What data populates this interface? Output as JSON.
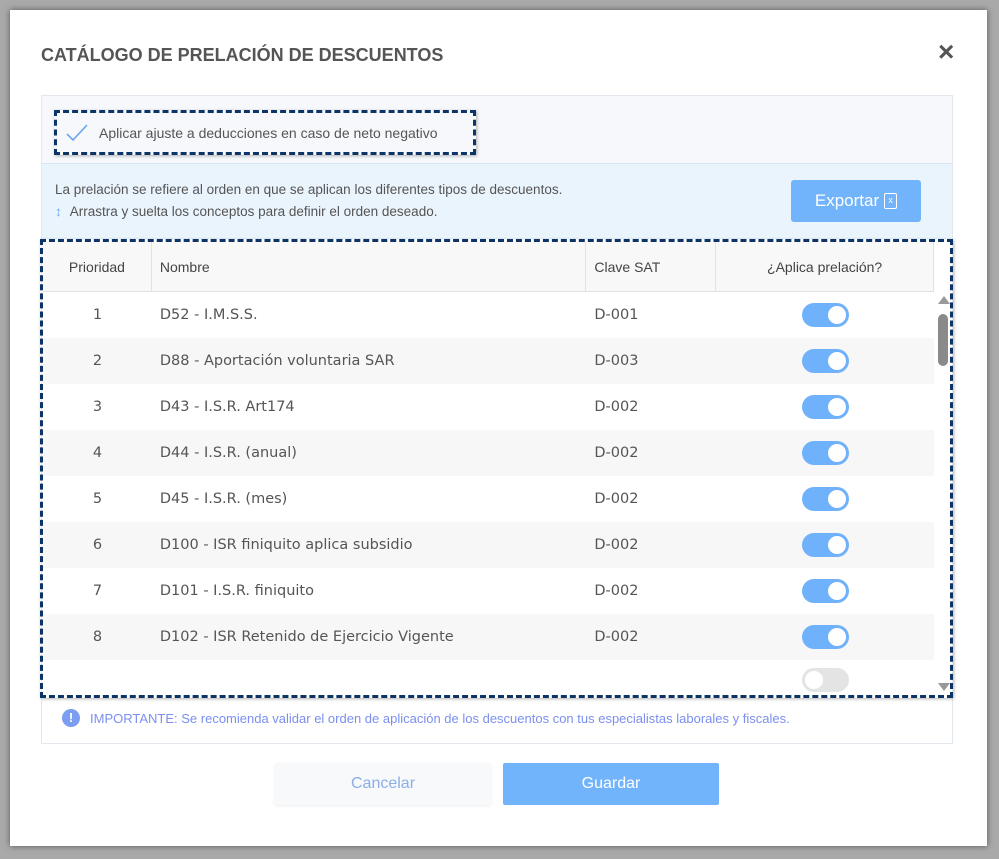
{
  "modal": {
    "title": "CATÁLOGO DE PRELACIÓN DE DESCUENTOS",
    "close_icon": "×"
  },
  "checkbox": {
    "label": "Aplicar ajuste a deducciones en caso de neto negativo",
    "checked": true
  },
  "info": {
    "line1": "La prelación se refiere al orden en que se aplican los diferentes tipos de descuentos.",
    "line2": "Arrastra y suelta los conceptos para definir el orden deseado.",
    "export_label": "Exportar"
  },
  "table": {
    "headers": [
      "Prioridad",
      "Nombre",
      "Clave SAT",
      "¿Aplica prelación?"
    ],
    "rows": [
      {
        "prioridad": "1",
        "nombre": "D52 - I.M.S.S.",
        "clave": "D-001",
        "aplica": true
      },
      {
        "prioridad": "2",
        "nombre": "D88 - Aportación voluntaria SAR",
        "clave": "D-003",
        "aplica": true
      },
      {
        "prioridad": "3",
        "nombre": "D43 - I.S.R. Art174",
        "clave": "D-002",
        "aplica": true
      },
      {
        "prioridad": "4",
        "nombre": "D44 - I.S.R. (anual)",
        "clave": "D-002",
        "aplica": true
      },
      {
        "prioridad": "5",
        "nombre": "D45 - I.S.R. (mes)",
        "clave": "D-002",
        "aplica": true
      },
      {
        "prioridad": "6",
        "nombre": "D100 - ISR finiquito aplica subsidio",
        "clave": "D-002",
        "aplica": true
      },
      {
        "prioridad": "7",
        "nombre": "D101 - I.S.R. finiquito",
        "clave": "D-002",
        "aplica": true
      },
      {
        "prioridad": "8",
        "nombre": "D102 - ISR Retenido de Ejercicio Vigente",
        "clave": "D-002",
        "aplica": true
      }
    ]
  },
  "note": "IMPORTANTE: Se recomienda validar el orden de aplicación de los descuentos con tus especialistas laborales y fiscales.",
  "buttons": {
    "cancel": "Cancelar",
    "save": "Guardar"
  },
  "colors": {
    "accent": "#72b4fb",
    "dashed_border": "#0d3466",
    "note": "#7b8ff0"
  }
}
